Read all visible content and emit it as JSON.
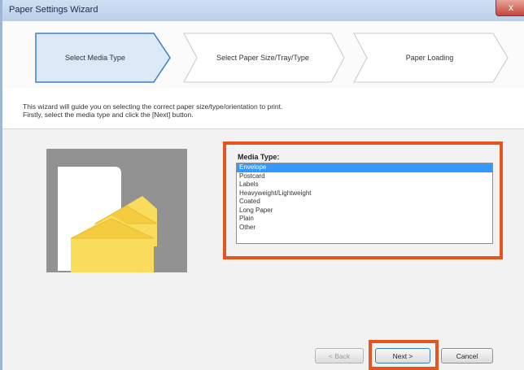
{
  "window": {
    "title": "Paper Settings Wizard",
    "close_glyph": "x"
  },
  "steps": [
    {
      "label": "Select Media Type",
      "active": true
    },
    {
      "label": "Select Paper Size/Tray/Type",
      "active": false
    },
    {
      "label": "Paper Loading",
      "active": false
    }
  ],
  "intro": {
    "line1": "This wizard will guide you on selecting the correct paper size/type/orientation to print.",
    "line2": "Firstly, select the media type and click the [Next] button."
  },
  "media": {
    "label": "Media Type:",
    "options": [
      "Envelope",
      "Postcard",
      "Labels",
      "Heavyweight/Lightweight",
      "Coated",
      "Long Paper",
      "Plain",
      "Other"
    ],
    "selected": "Envelope"
  },
  "buttons": {
    "back": "< Back",
    "next": "Next >",
    "cancel": "Cancel"
  },
  "colors": {
    "highlight": "#e4561e",
    "selection": "#3399ff",
    "active_step": "#dce9f7",
    "envelope": "#f9dc5c"
  }
}
